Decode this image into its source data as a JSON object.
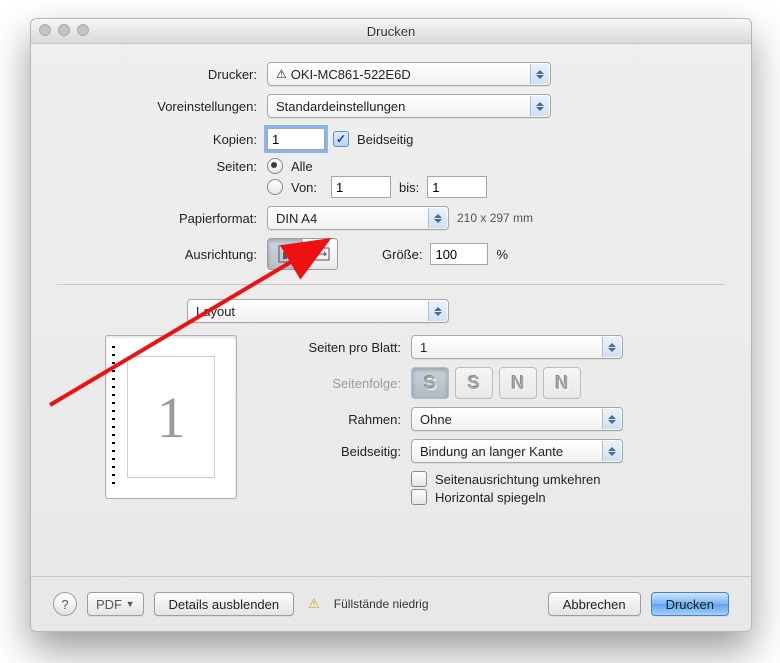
{
  "title": "Drucken",
  "labels": {
    "printer": "Drucker:",
    "presets": "Voreinstellungen:",
    "copies": "Kopien:",
    "two_sided": "Beidseitig",
    "pages": "Seiten:",
    "pages_all": "Alle",
    "pages_from": "Von:",
    "pages_to": "bis:",
    "paper": "Papierformat:",
    "orientation": "Ausrichtung:",
    "scale": "Größe:",
    "scale_suffix": "%",
    "section": "Layout",
    "pages_per_sheet": "Seiten pro Blatt:",
    "layout_dir": "Seitenfolge:",
    "border": "Rahmen:",
    "two_sided_mode": "Beidseitig:",
    "reverse_orientation": "Seitenausrichtung umkehren",
    "flip_horizontal": "Horizontal spiegeln"
  },
  "values": {
    "printer": "OKI-MC861-522E6D",
    "preset": "Standardeinstellungen",
    "copies": "1",
    "two_sided_checked": true,
    "pages_mode": "all",
    "page_from": "1",
    "page_to": "1",
    "paper": "DIN A4",
    "paper_dims": "210 x 297 mm",
    "orientation": "portrait",
    "scale": "100",
    "pages_per_sheet": "1",
    "border": "Ohne",
    "two_sided_mode": "Bindung an langer Kante",
    "reverse_orientation": false,
    "flip_horizontal": false,
    "preview_page": "1"
  },
  "buttons": {
    "pdf": "PDF",
    "hide_details": "Details ausblenden",
    "supplies_low": "Füllstände niedrig",
    "cancel": "Abbrechen",
    "print": "Drucken"
  }
}
